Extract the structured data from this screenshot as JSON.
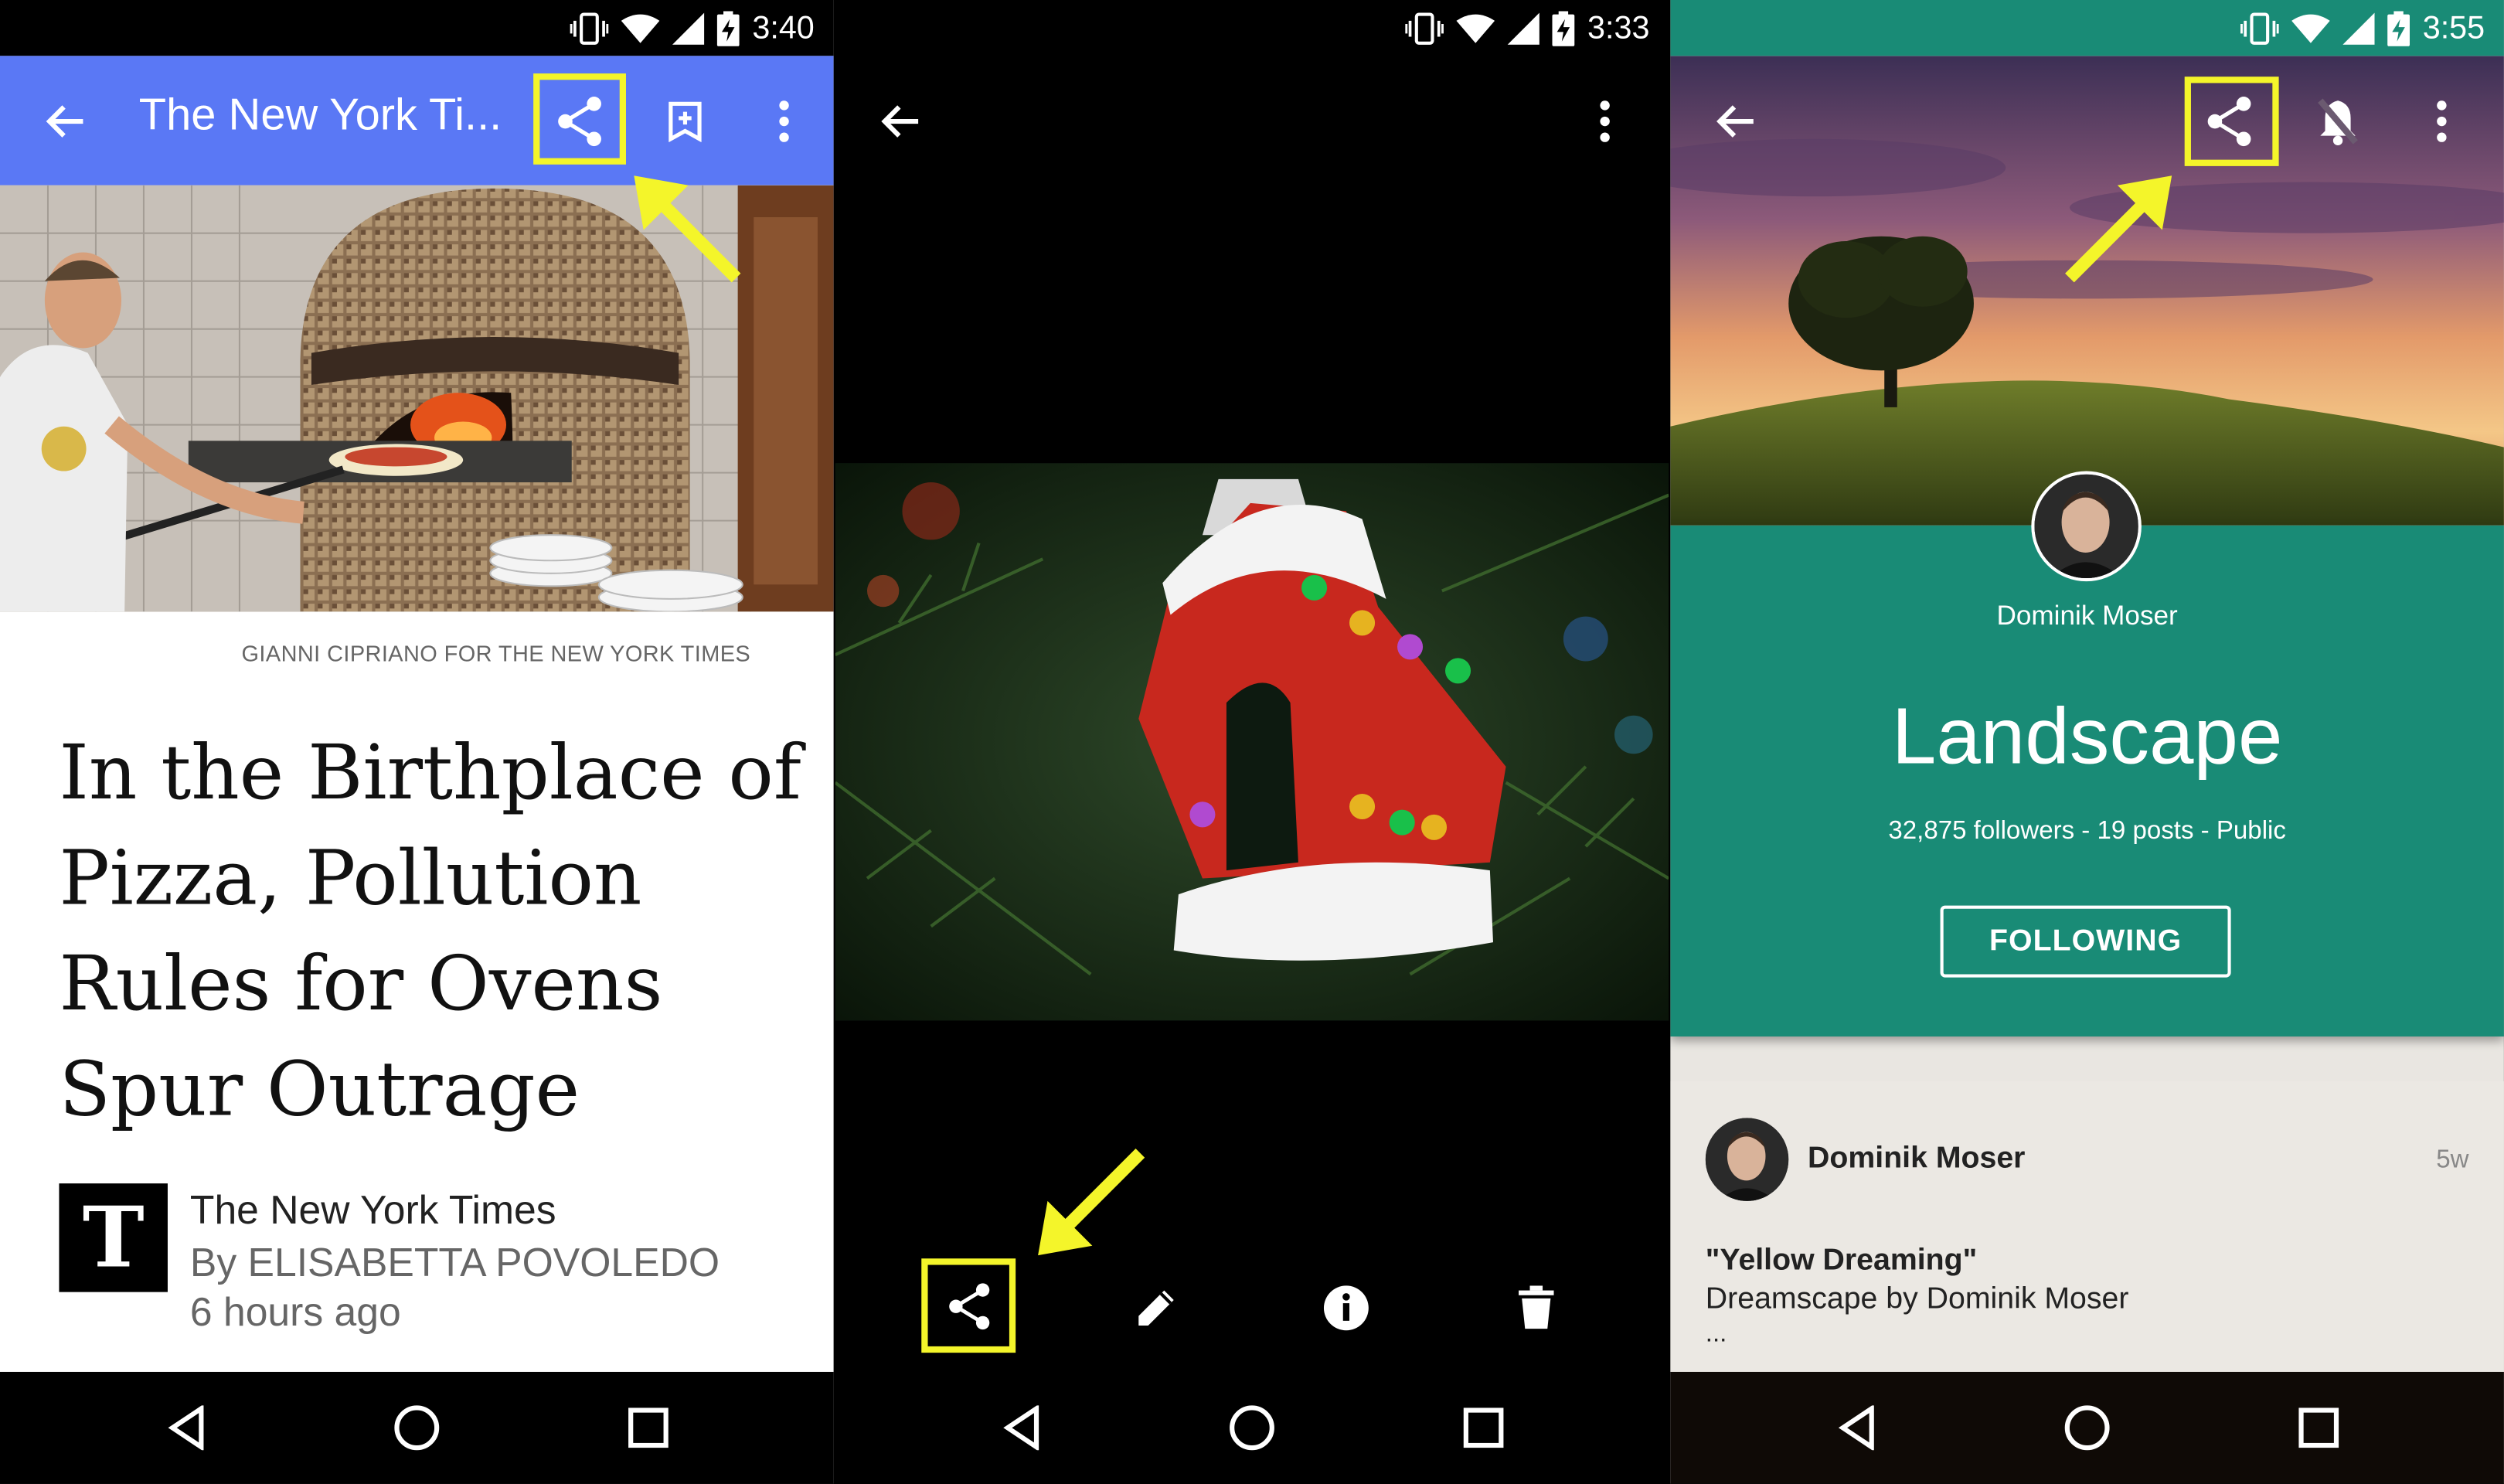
{
  "colors": {
    "highlight": "#f4f52a",
    "nyt_appbar": "#5a78f5",
    "collection_green": "#198b76"
  },
  "screens": [
    {
      "status_time": "3:40",
      "title": "The New York Ti...",
      "actions": [
        "back-arrow-icon",
        "share-icon",
        "bookmark-add-icon",
        "more-vert-icon"
      ],
      "photo_credit": "GIANNI CIPRIANO FOR THE NEW YORK TIMES",
      "headline": "In the Birthplace of Pizza, Pollution Rules for Ovens Spur Outrage",
      "publisher": "The New York Times",
      "byline": "By ELISABETTA POVOLEDO",
      "time_ago": "6 hours ago",
      "logo_letter": "T"
    },
    {
      "status_time": "3:33",
      "actions": [
        "back-arrow-icon",
        "more-vert-icon"
      ],
      "bottom_actions": [
        "share-icon",
        "edit-pencil-icon",
        "info-icon",
        "delete-icon"
      ]
    },
    {
      "status_time": "3:55",
      "actions": [
        "back-arrow-icon",
        "share-icon",
        "notifications-off-icon",
        "more-vert-icon"
      ],
      "owner": "Dominik Moser",
      "collection_title": "Landscape",
      "stats": "32,875 followers - 19 posts - Public",
      "follow_button": "FOLLOWING",
      "post": {
        "author": "Dominik Moser",
        "time": "5w",
        "title": "\"Yellow Dreaming\"",
        "subtitle": "Dreamscape by Dominik Moser",
        "more": "..."
      }
    }
  ],
  "navbar": [
    "back-triangle-icon",
    "home-circle-icon",
    "recents-square-icon"
  ]
}
